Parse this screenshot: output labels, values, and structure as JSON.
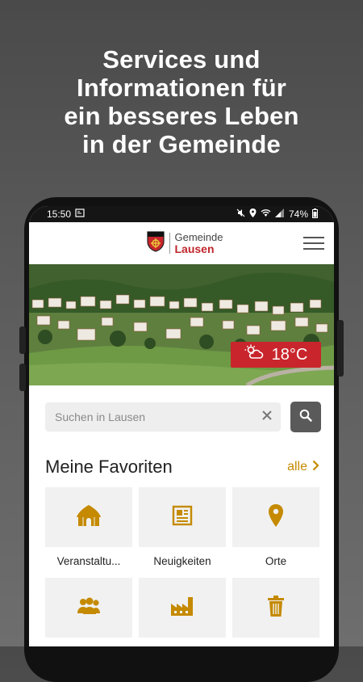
{
  "promo": {
    "lines": [
      "Services und",
      "Informationen für",
      "ein besseres Leben",
      "in der Gemeinde"
    ]
  },
  "statusbar": {
    "time": "15:50",
    "battery": "74%"
  },
  "header": {
    "logo_line1": "Gemeinde",
    "logo_line2": "Lausen"
  },
  "weather": {
    "temperature": "18°C",
    "icon": "partly-cloudy-icon"
  },
  "search": {
    "placeholder": "Suchen in Lausen",
    "value": ""
  },
  "favorites": {
    "title": "Meine Favoriten",
    "all_label": "alle",
    "items": [
      {
        "label": "Veranstaltu...",
        "icon": "tent-icon"
      },
      {
        "label": "Neuigkeiten",
        "icon": "newspaper-icon"
      },
      {
        "label": "Orte",
        "icon": "location-pin-icon"
      },
      {
        "label": "",
        "icon": "people-icon"
      },
      {
        "label": "",
        "icon": "factory-icon"
      },
      {
        "label": "",
        "icon": "trash-icon"
      }
    ]
  },
  "colors": {
    "accent": "#c58a00",
    "brand_red": "#c9252c"
  }
}
